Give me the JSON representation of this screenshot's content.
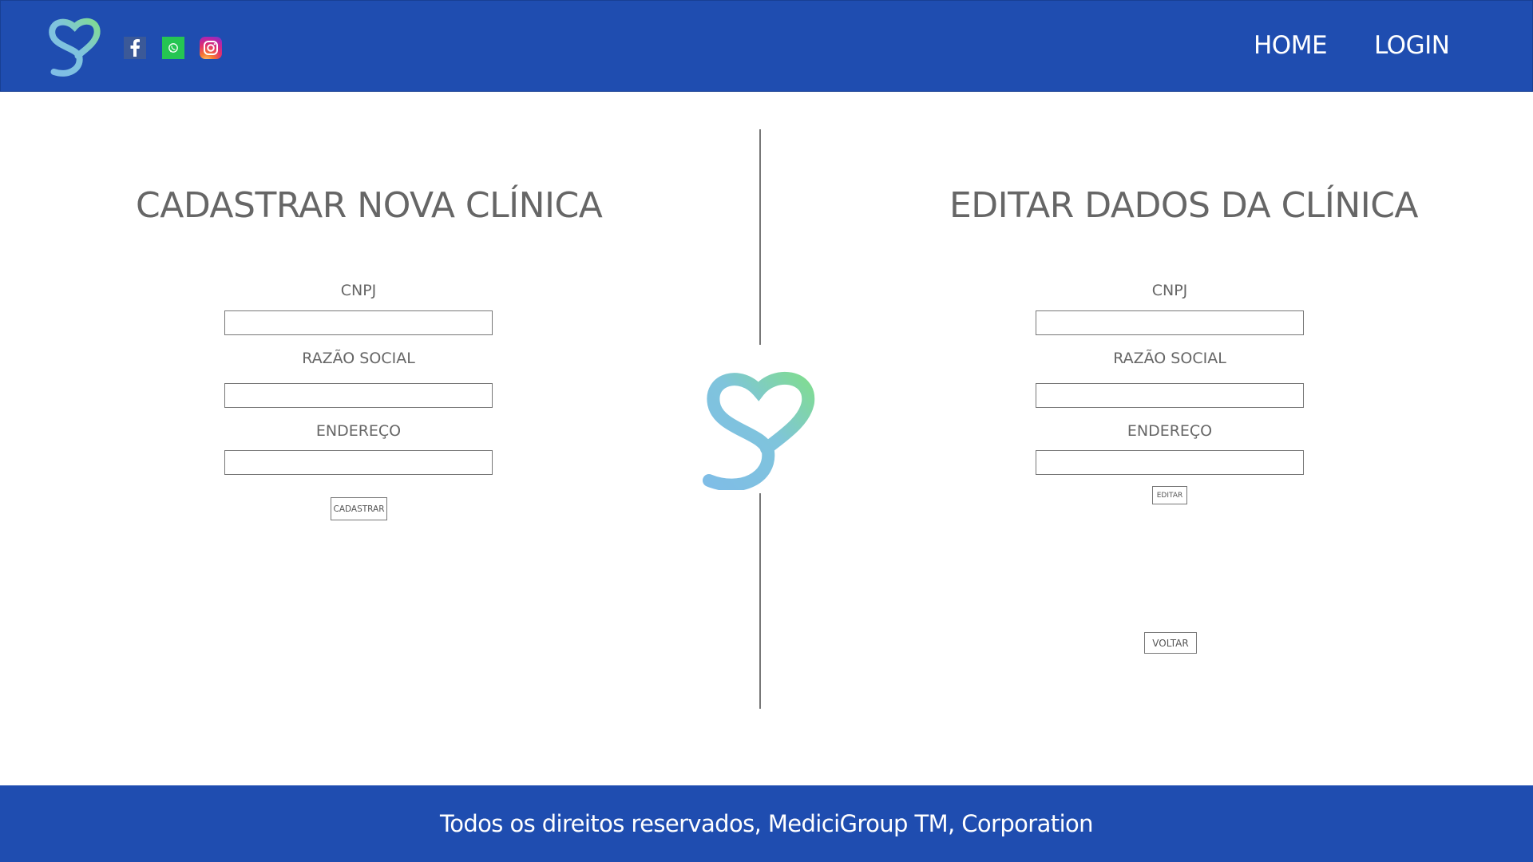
{
  "header": {
    "social": [
      {
        "icon": "facebook-icon",
        "color": "#3b5998"
      },
      {
        "icon": "whatsapp-icon",
        "color": "#25c552"
      },
      {
        "icon": "instagram-icon",
        "color": "#e1306c"
      }
    ],
    "nav": {
      "home_label": "HOME",
      "login_label": "LOGIN"
    }
  },
  "register": {
    "title": "CADASTRAR NOVA CLÍNICA",
    "cnpj_label": "CNPJ",
    "cnpj_value": "",
    "razao_label": "RAZÃO SOCIAL",
    "razao_value": "",
    "endereco_label": "ENDEREÇO",
    "endereco_value": "",
    "submit_label": "CADASTRAR"
  },
  "edit": {
    "title": "EDITAR DADOS DA CLÍNICA",
    "cnpj_label": "CNPJ",
    "cnpj_value": "",
    "razao_label": "RAZÃO SOCIAL",
    "razao_value": "",
    "endereco_label": "ENDEREÇO",
    "endereco_value": "",
    "submit_label": "EDITAR",
    "back_label": "VOLTAR"
  },
  "footer": {
    "text": "Todos os direitos reservados, MediciGroup TM, Corporation"
  },
  "colors": {
    "primary": "#1f4db0",
    "logo_blue": "#7fbde6",
    "logo_green": "#80dc92",
    "text_gray": "#666666"
  }
}
